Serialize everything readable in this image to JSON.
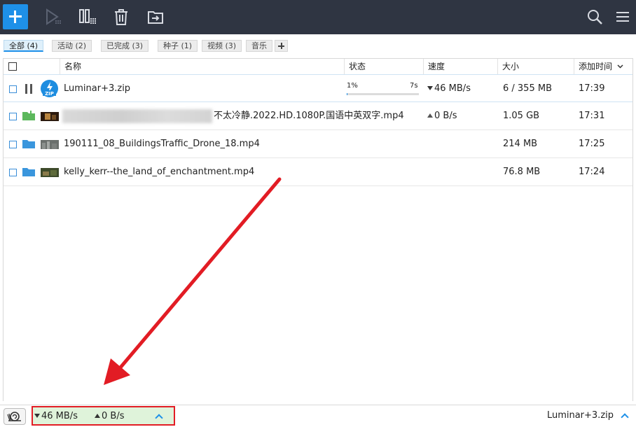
{
  "tabs": [
    {
      "label": "全部 (4)"
    },
    {
      "label": "活动 (2)"
    },
    {
      "label": "已完成 (3)"
    },
    {
      "label": "种子 (1)"
    },
    {
      "label": "视频 (3)"
    },
    {
      "label": "音乐"
    }
  ],
  "columns": {
    "name": "名称",
    "status": "状态",
    "speed": "速度",
    "size": "大小",
    "added": "添加时间"
  },
  "rows": [
    {
      "name": "Luminar+3.zip",
      "progress_pct": "1%",
      "progress": 0.01,
      "eta": "7s",
      "speed": "46 MB/s",
      "size": "6 / 355 MB",
      "time": "17:39"
    },
    {
      "name": "不太冷静.2022.HD.1080P.国语中英双字.mp4",
      "speed": "0 B/s",
      "size": "1.05 GB",
      "time": "17:31"
    },
    {
      "name": "190111_08_BuildingsTraffic_Drone_18.mp4",
      "size": "214 MB",
      "time": "17:25"
    },
    {
      "name": "kelly_kerr--the_land_of_enchantment.mp4",
      "size": "76.8 MB",
      "time": "17:24"
    }
  ],
  "status_bar": {
    "down_speed": "46 MB/s",
    "up_speed": "0 B/s",
    "current_file": "Luminar+3.zip"
  },
  "zip_label": "ZIP",
  "colors": {
    "toolbar": "#2f3542",
    "accent": "#1e90e8",
    "annotation": "#e21c24"
  }
}
